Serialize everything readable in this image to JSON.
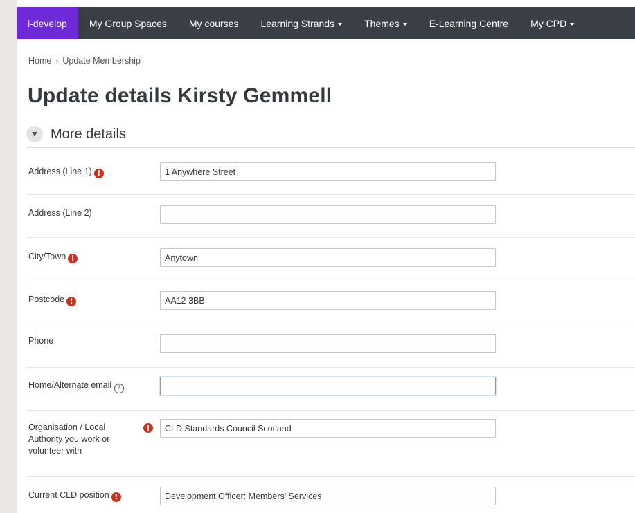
{
  "nav": {
    "brand": "i-develop",
    "items": [
      {
        "label": "My Group Spaces",
        "dropdown": false
      },
      {
        "label": "My courses",
        "dropdown": false
      },
      {
        "label": "Learning Strands",
        "dropdown": true
      },
      {
        "label": "Themes",
        "dropdown": true
      },
      {
        "label": "E-Learning Centre",
        "dropdown": false
      },
      {
        "label": "My CPD",
        "dropdown": true
      }
    ]
  },
  "breadcrumb": {
    "home": "Home",
    "separator": "›",
    "current": "Update Membership"
  },
  "page": {
    "title": "Update details Kirsty Gemmell"
  },
  "section": {
    "title": "More details",
    "toggle_icon": "chevron-down-icon"
  },
  "form": {
    "address1": {
      "label": "Address (Line 1)",
      "value": "1 Anywhere Street",
      "required": true
    },
    "address2": {
      "label": "Address (Line 2)",
      "value": "",
      "required": false
    },
    "city": {
      "label": "City/Town",
      "value": "Anytown",
      "required": true
    },
    "postcode": {
      "label": "Postcode",
      "value": "AA12 3BB",
      "required": true
    },
    "phone": {
      "label": "Phone",
      "value": "",
      "required": false
    },
    "alt_email": {
      "label": "Home/Alternate email",
      "value": "",
      "required": false,
      "help_icon": "question-circle-icon"
    },
    "organisation": {
      "label": "Organisation / Local Authority you work or volunteer with",
      "value": "CLD Standards Council Scotland",
      "required": true
    },
    "position": {
      "label": "Current CLD position",
      "value": "Development Officer: Members' Services",
      "required": true
    }
  },
  "icons": {
    "required": "!",
    "help": "?"
  },
  "colors": {
    "brand": "#6f2ad8",
    "nav_bg": "#3a3f45",
    "required": "#ca3120",
    "focus": "#6da4d8"
  }
}
